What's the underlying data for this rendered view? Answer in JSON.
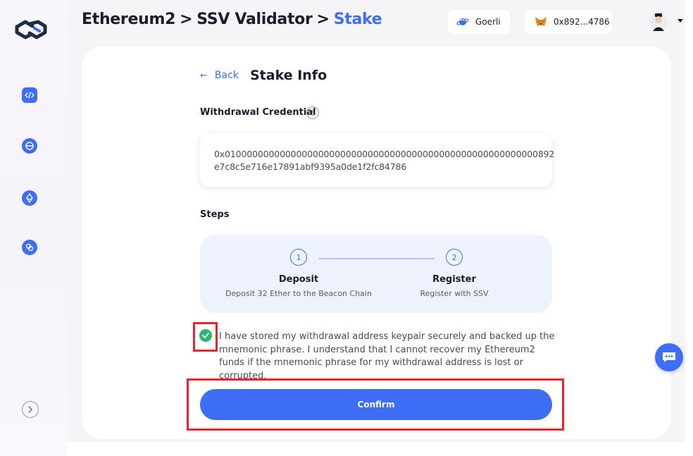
{
  "breadcrumb": {
    "items": [
      "Ethereum2",
      "SSV Validator",
      "Stake"
    ],
    "separator": ">"
  },
  "header": {
    "network_label": "Goerli",
    "wallet_label": "0x892...4786"
  },
  "sidebar": {
    "icons": [
      "code-icon",
      "network-icon",
      "ethereum-icon",
      "link-icon"
    ]
  },
  "page": {
    "back_label": "Back",
    "title": "Stake Info",
    "withdrawal_credential_label": "Withdrawal Credential",
    "credential_line1": "0x010000000000000000000000000000000000000000000000000000000892",
    "credential_line2": "e7c8c5e716e17891abf9395a0de1f2fc84786",
    "steps_label": "Steps",
    "steps": [
      {
        "number": "1",
        "title": "Deposit",
        "desc": "Deposit 32 Ether to the Beacon Chain"
      },
      {
        "number": "2",
        "title": "Register",
        "desc": "Register with SSV"
      }
    ],
    "agreement_text": "I have stored my withdrawal address keypair securely and backed up the mnemonic phrase. I understand that I cannot recover my Ethereum2 funds if the mnemonic phrase for my withdrawal address is lost or corrupted.",
    "agreement_checked": true,
    "confirm_label": "Confirm"
  },
  "colors": {
    "accent": "#3e6ef5",
    "check": "#2bb673",
    "highlight": "#e3262f"
  }
}
